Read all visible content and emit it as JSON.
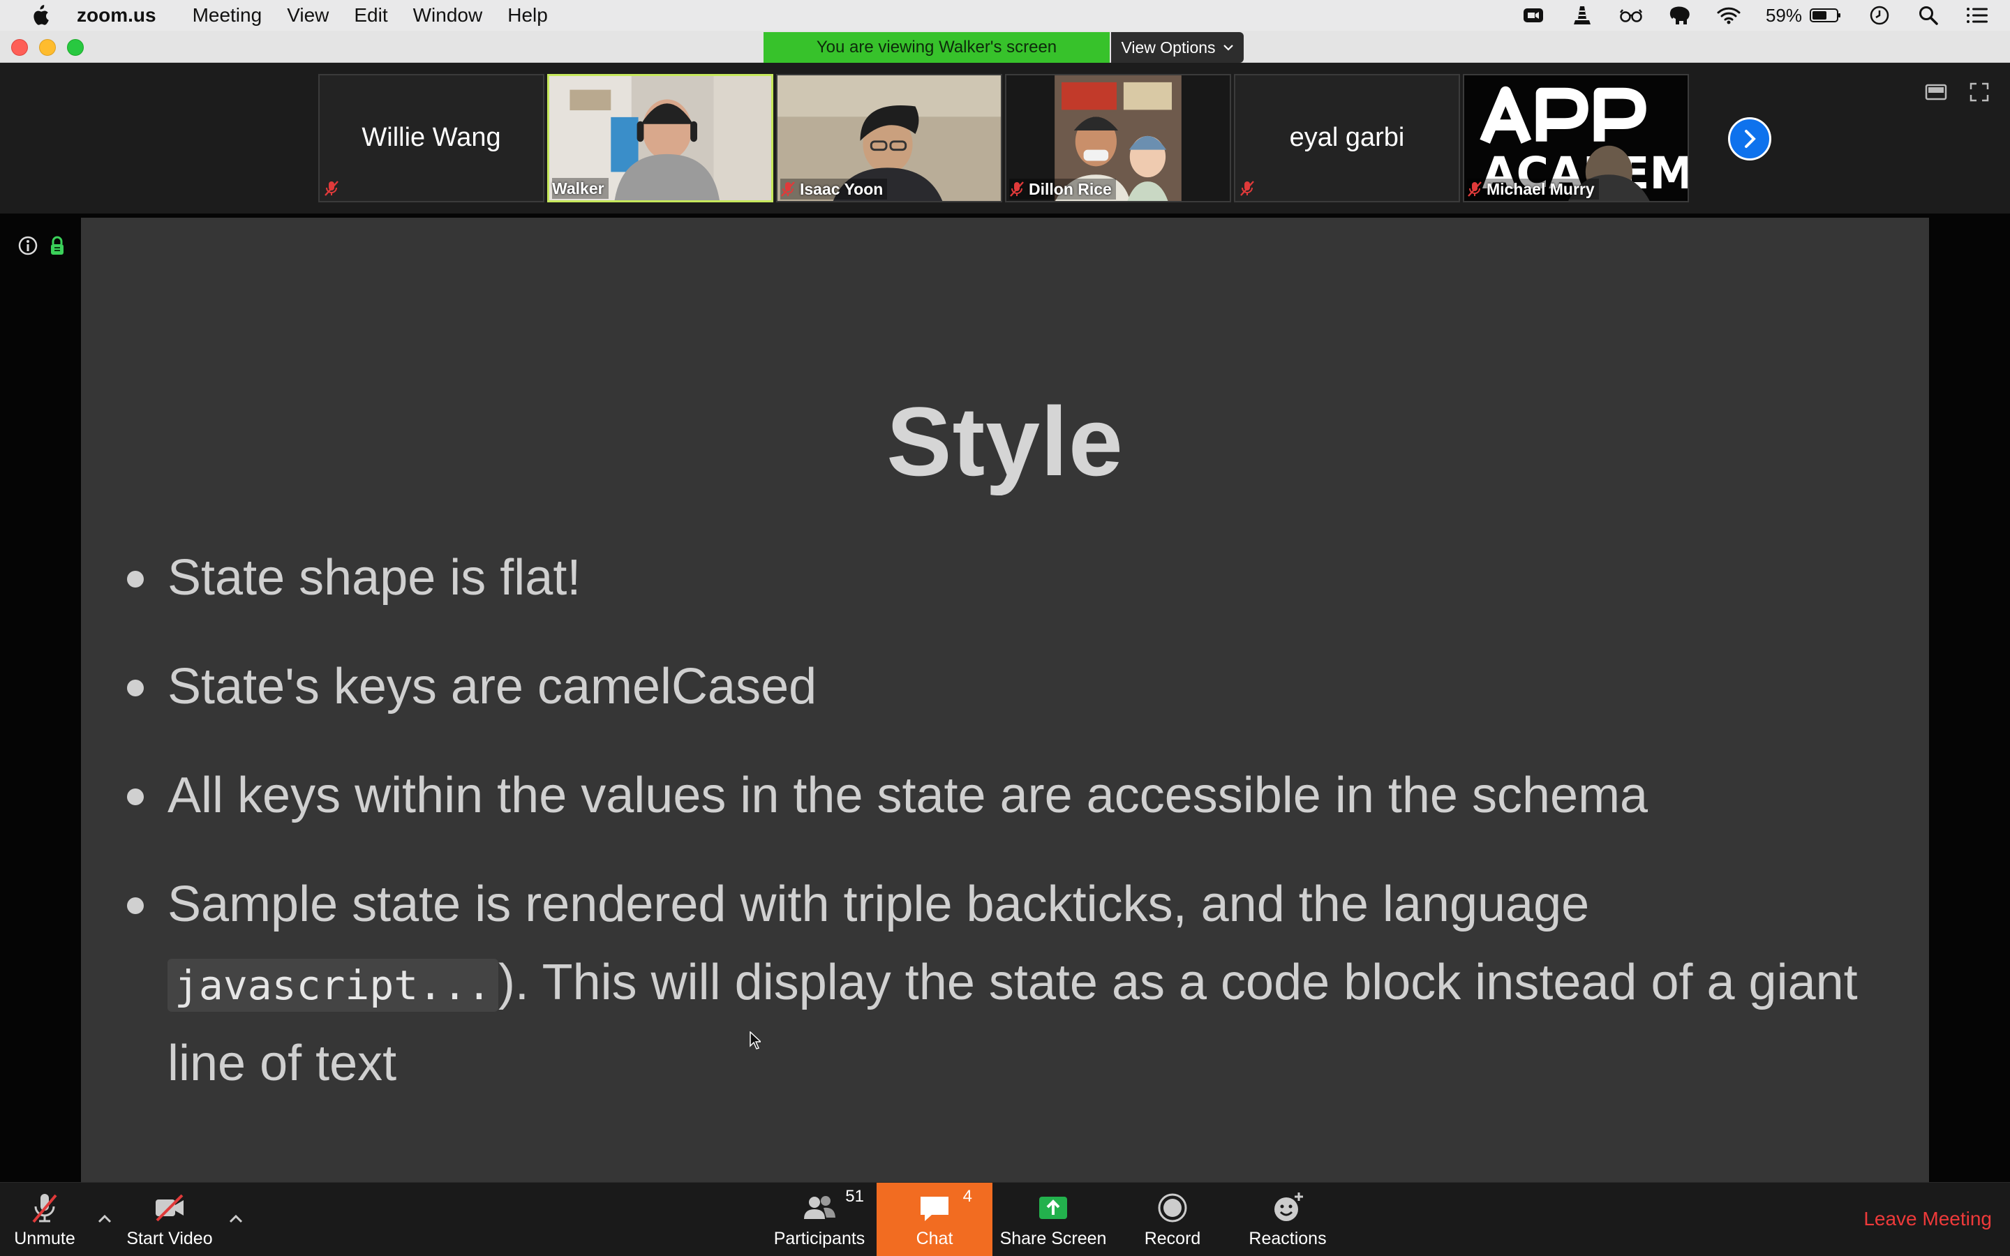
{
  "menubar": {
    "app_name": "zoom.us",
    "items": [
      "Meeting",
      "View",
      "Edit",
      "Window",
      "Help"
    ],
    "battery_percent": "59%",
    "status_icons": [
      "zoom-icon",
      "vlc-icon",
      "glasses-icon",
      "elephant-icon",
      "wifi-icon",
      "battery-icon",
      "clock-icon",
      "search-icon",
      "control-center-icon"
    ]
  },
  "banner": {
    "viewing_text": "You are viewing Walker's screen",
    "view_options_label": "View Options"
  },
  "participants_strip": [
    {
      "name": "Willie Wang",
      "display": "name-only",
      "muted": true
    },
    {
      "name": "Walker",
      "display": "video",
      "muted": false,
      "active_speaker": true
    },
    {
      "name": "Isaac Yoon",
      "display": "video",
      "muted": true
    },
    {
      "name": "Dillon Rice",
      "display": "video",
      "muted": true
    },
    {
      "name": "eyal garbi",
      "display": "name-only",
      "muted": true
    },
    {
      "name": "Michael Murry",
      "display": "video",
      "muted": true,
      "overlay_logo_text": "APP ACADEMY"
    }
  ],
  "slide": {
    "title": "Style",
    "bullets": [
      "State shape is flat!",
      "State's keys are camelCased",
      "All keys within the values in the state are accessible in the schema"
    ],
    "bullet4_part1": "Sample state is rendered with triple backticks, and the language ",
    "bullet4_code": "javascript...",
    "bullet4_part2": "). This will display the state as a code block instead of a giant line of text"
  },
  "toolbar": {
    "unmute_label": "Unmute",
    "start_video_label": "Start Video",
    "participants_label": "Participants",
    "participants_count": "51",
    "chat_label": "Chat",
    "chat_count": "4",
    "share_screen_label": "Share Screen",
    "record_label": "Record",
    "reactions_label": "Reactions",
    "leave_label": "Leave Meeting"
  },
  "colors": {
    "banner_green": "#37c22b",
    "chat_orange": "#f26c21",
    "leave_red": "#ee3a3a",
    "next_blue": "#0e72ed",
    "active_speaker_border": "#c6e85c"
  }
}
